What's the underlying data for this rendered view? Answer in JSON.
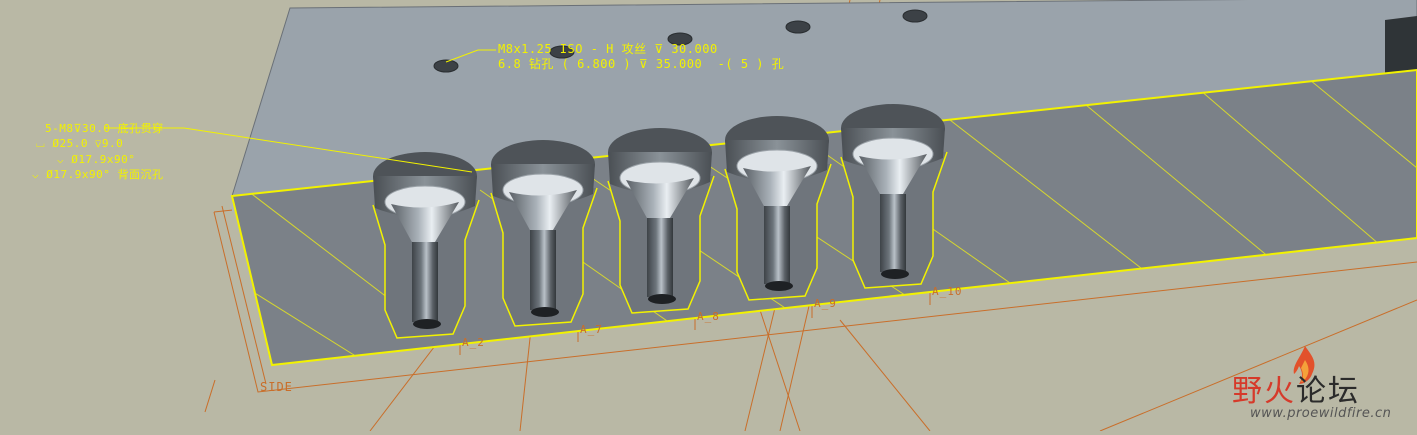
{
  "viewport": {
    "hole_note": {
      "line1": "M8x1.25 ISO - H 攻丝 ⊽ 30.000",
      "line2": "6.8 钻孔 ( 6.800 ) ⊽ 35.000  -( 5 ) 孔"
    },
    "counterbore_note": {
      "line1": "5-M8⊽30.0 底孔贯穿",
      "line2": "⌴ Ø25.0 ⊽9.0",
      "line3": "⌵ Ø17.9x90°",
      "line4": "⌵ Ø17.9x90° 背面沉孔"
    },
    "datum_labels": [
      "A_2",
      "A_7",
      "A_8",
      "A_9",
      "A_10"
    ],
    "section_label": "SIDE",
    "colors": {
      "background": "#b9b8a5",
      "annotation": "#f2f200",
      "datum": "#c96e2a",
      "part_top": "#9da6ae",
      "section_face": "#7a8087"
    }
  },
  "watermark": {
    "title_part1": "野火",
    "title_part2": "论坛",
    "url": "www.proewildfire.cn",
    "flame_icon": "flame-icon"
  }
}
